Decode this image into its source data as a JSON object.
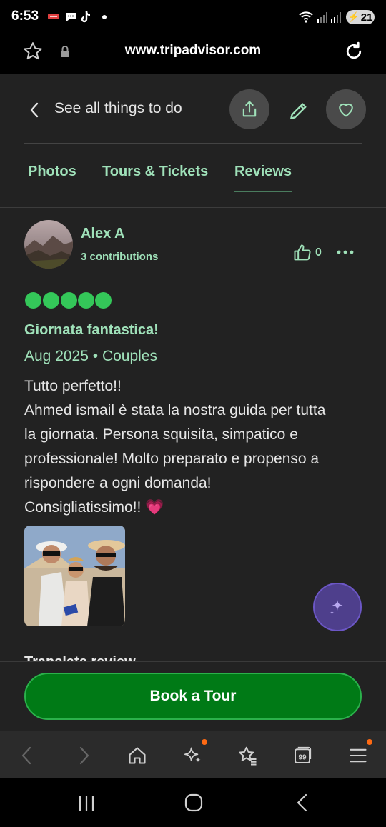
{
  "status_bar": {
    "time": "6:53",
    "battery": "21"
  },
  "browser": {
    "url": "www.tripadvisor.com"
  },
  "header": {
    "back_label": "See all things to do"
  },
  "tabs": [
    {
      "label": "Photos"
    },
    {
      "label": "Tours & Tickets"
    },
    {
      "label": "Reviews",
      "active": true
    }
  ],
  "review": {
    "author": "Alex A",
    "contributions": "3 contributions",
    "likes": "0",
    "rating_bubbles": 5,
    "title": "Giornata fantastica!",
    "meta": "Aug 2025 • Couples",
    "body_lines": [
      "Tutto perfetto!!",
      "Ahmed ismail è stata la nostra guida per tutta",
      "la giornata. Persona squisita, simpatico e",
      "professionale! Molto preparato e propenso a",
      "rispondere a ogni domanda!",
      "Consigliatissimo!! 💗"
    ],
    "translate_label": "Translate review"
  },
  "cta": {
    "book_label": "Book a Tour"
  },
  "colors": {
    "accent_green": "#9fe1b9",
    "rating_green": "#34c759",
    "button_green": "#007a16",
    "ai_purple": "#4e3f8c",
    "notif_orange": "#ff6a13"
  }
}
